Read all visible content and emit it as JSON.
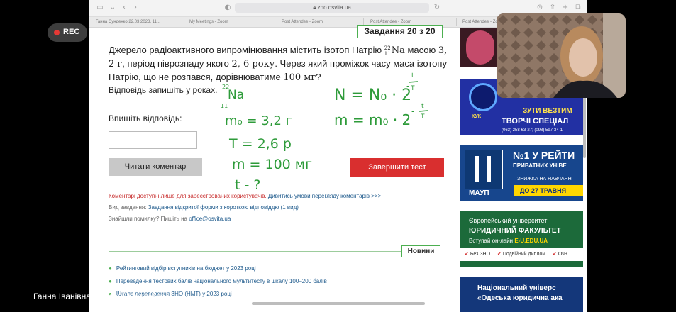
{
  "browser": {
    "url": "zno.osvita.ua",
    "tabs": [
      "Ганна Сунденко 22.03.2023, 11...",
      "My Meetings - Zoom",
      "Post Attendee - Zoom",
      "Post Attendee - Zoom",
      "Post Attendee - Zoom"
    ]
  },
  "task": {
    "label": "Завдання 20 з 20",
    "question_part1": "Джерело радіоактивного випромінювання містить ізотоп Натрію ",
    "isotope_mass": "22",
    "isotope_number": "11",
    "isotope_symbol": "Na",
    "question_part2": " масою ",
    "mass_value": "3, 2 г",
    "question_part3": ", період піврозпаду якого ",
    "halflife_value": "2, 6 року",
    "question_part4": ". Через який проміжок часу маса ізотопу Натрію, що не розпався, дорівнюватиме ",
    "target_value": "100 мг",
    "question_part5": "?",
    "answer_note": "Відповідь запишіть у роках.",
    "enter_answer_label": "Впишіть відповідь:",
    "answer_value": "",
    "read_comment_button": "Читати коментар",
    "finish_test_button": "Завершити тест",
    "comments_note": "Коментарі доступні лише для зареєстрованих користувачів.",
    "comments_note_link": " Дивитись умови перегляду коментарів >>>.",
    "task_type_label": "Вид завдання: ",
    "task_type_value": "Завдання відкритої форми з короткою відповіддю (1 вид)",
    "error_note": "Знайшли помилку? Пишіть на ",
    "error_email": "office@osvita.ua"
  },
  "news": {
    "label": "Новини",
    "items": [
      "Рейтинговий відбір вступників на бюджет у 2023 році",
      "Переведення тестових балів національного мультитесту в шкалу 100–200 балів",
      "Шкала переведення ЗНО (НМТ) у 2023 році"
    ]
  },
  "handwriting": {
    "isotope": "Na",
    "isotope_number": "11",
    "isotope_mass": "22",
    "given": [
      "m₀ = 3,2 г",
      "T = 2,6 р",
      "m = 100 мг",
      "t - ?"
    ],
    "formula1": "N = N₀ · 2",
    "formula2": "m = m₀ · 2",
    "exp_num": "t",
    "exp_den": "T",
    "exp_sign": "-"
  },
  "ads": {
    "ad2_badge": "КУК",
    "ad2_text": "ЗУТИ ВЕЗТИМ",
    "ad2_title": "ТВОРЧІ СПЕЦІАЛ",
    "ad2_phone": "(063) 258-63-27; (098) 597-34-1",
    "ad3_logo": "МАУП",
    "ad3_title": "№1 У РЕЙТИ",
    "ad3_sub": "ПРИВАТНИХ УНІВЕ",
    "ad3_discount": "ЗНИЖКА НА НАВЧАНН",
    "ad3_date": "ДО 27 ТРАВНЯ",
    "ad4_line1": "Європейський університет",
    "ad4_line2": "ЮРИДИЧНИЙ ФАКУЛЬТЕТ",
    "ad4_line3": "Вступай он-лайн",
    "ad4_site": "E-U.EDU.UA",
    "ad4_perk1": "Без ЗНО",
    "ad4_perk2": "Подвійний диплом",
    "ad4_perk3": "Очн",
    "ad5_line1": "Національний універс",
    "ad5_line2": "«Одеська юридична ака"
  },
  "zoom": {
    "rec_label": "REC",
    "share_label": "Ганна Іванівна Сунденко's screen"
  },
  "colors": {
    "accent_green": "#4caf50",
    "finish_red": "#d92f2f",
    "link_blue": "#1e5a8c",
    "ink_green": "#2e9b3a"
  }
}
